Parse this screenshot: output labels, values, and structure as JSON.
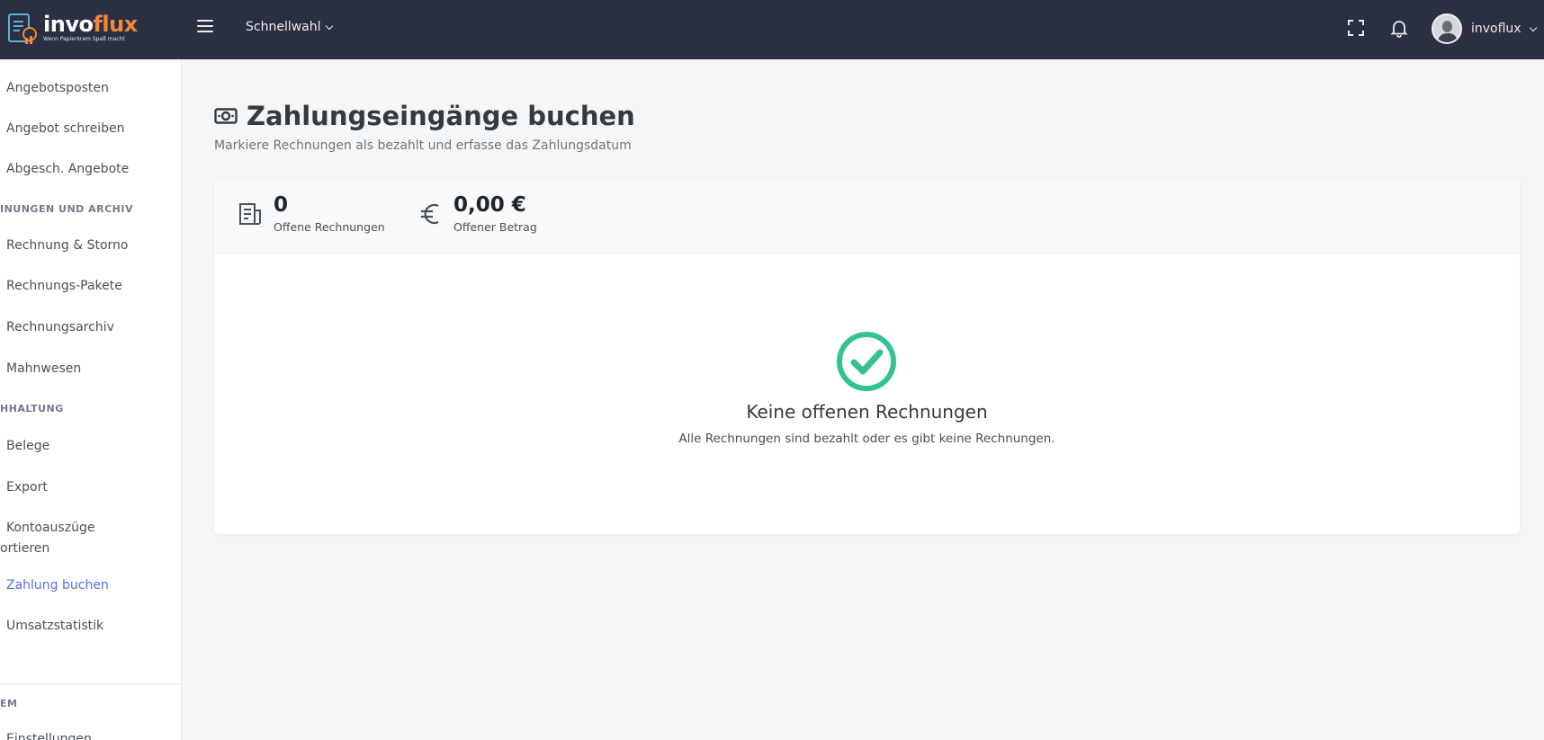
{
  "brand": {
    "name_part1": "invo",
    "name_part2": "flux",
    "tagline": "Wenn Papierkram Spaß macht"
  },
  "topbar": {
    "quick_select_label": "Schnellwahl",
    "user_name": "invoflux"
  },
  "sidebar": {
    "items_top": [
      {
        "label": "Angebotsposten"
      },
      {
        "label": "Angebot schreiben"
      },
      {
        "label": "Abgesch. Angebote"
      }
    ],
    "section_invoices": "INUNGEN UND ARCHIV",
    "items_invoices": [
      {
        "label": "Rechnung & Storno"
      },
      {
        "label": "Rechnungs-Pakete"
      },
      {
        "label": "Rechnungsarchiv"
      },
      {
        "label": "Mahnwesen"
      }
    ],
    "section_bookkeeping": "HHALTUNG",
    "items_bookkeeping": [
      {
        "label": "Belege"
      },
      {
        "label": "Export"
      },
      {
        "label": "Kontoauszüge",
        "label_line2": "ortieren"
      },
      {
        "label": "Zahlung buchen"
      },
      {
        "label": "Umsatzstatistik"
      }
    ],
    "section_system": "EM",
    "item_settings": "Einstellungen"
  },
  "page": {
    "title": "Zahlungseingänge buchen",
    "subtitle": "Markiere Rechnungen als bezahlt und erfasse das Zahlungsdatum"
  },
  "stats": {
    "open_invoices_count": "0",
    "open_invoices_label": "Offene Rechnungen",
    "open_amount": "0,00 €",
    "open_amount_label": "Offener Betrag"
  },
  "empty_state": {
    "title": "Keine offenen Rechnungen",
    "message": "Alle Rechnungen sind bezahlt oder es gibt keine Rechnungen."
  },
  "colors": {
    "topbar": "#2a3042",
    "accent": "#556ee6",
    "brand_orange": "#f1873a",
    "success": "#34c38f"
  }
}
